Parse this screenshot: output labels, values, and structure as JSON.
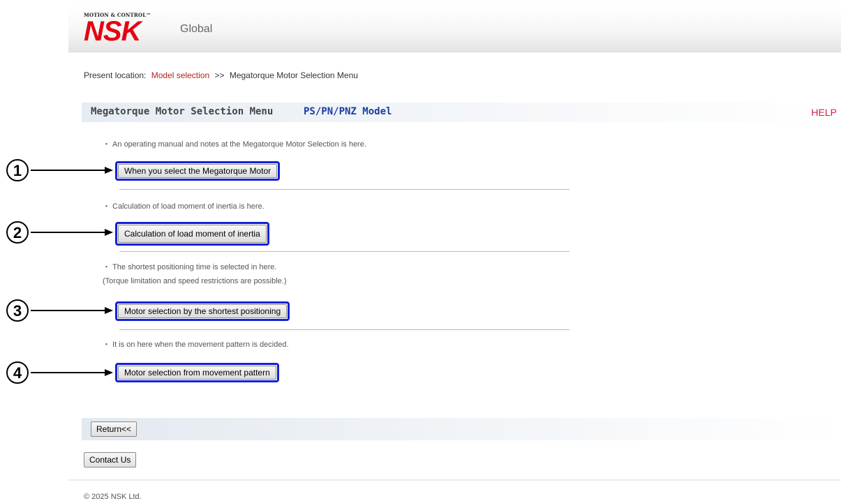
{
  "header": {
    "logo_tag": "MOTION & CONTROL™",
    "logo_text": "NSK",
    "site_label": "Global"
  },
  "breadcrumb": {
    "prefix": "Present location:",
    "link": "Model selection",
    "separator": ">>",
    "current": "Megatorque Motor Selection Menu"
  },
  "title": {
    "main": "Megatorque Motor Selection Menu",
    "model": "PS/PN/PNZ Model",
    "help": "HELP"
  },
  "sections": [
    {
      "marker": "①",
      "desc": [
        "・ An operating manual and notes at the Megatorque Motor Selection is here."
      ],
      "button": "When you select the Megatorque Motor"
    },
    {
      "marker": "②",
      "desc": [
        "・ Calculation of load moment of inertia is here."
      ],
      "button": "Calculation of load moment of inertia"
    },
    {
      "marker": "③",
      "desc": [
        "・ The shortest positioning time is selected in here.",
        "(Torque limitation and speed restrictions are possible.)"
      ],
      "button": "Motor selection by the shortest positioning"
    },
    {
      "marker": "④",
      "desc": [
        "・ It is on here when the movement pattern is decided."
      ],
      "button": "Motor selection from movement pattern"
    }
  ],
  "footer": {
    "return_label": "Return<<",
    "contact_label": "Contact Us",
    "copyright": "© 2025  NSK Ltd."
  },
  "colors": {
    "brand_red": "#e60012",
    "highlight_blue": "#1422d8",
    "model_blue": "#1a3fa0",
    "link_red": "#b22222"
  }
}
